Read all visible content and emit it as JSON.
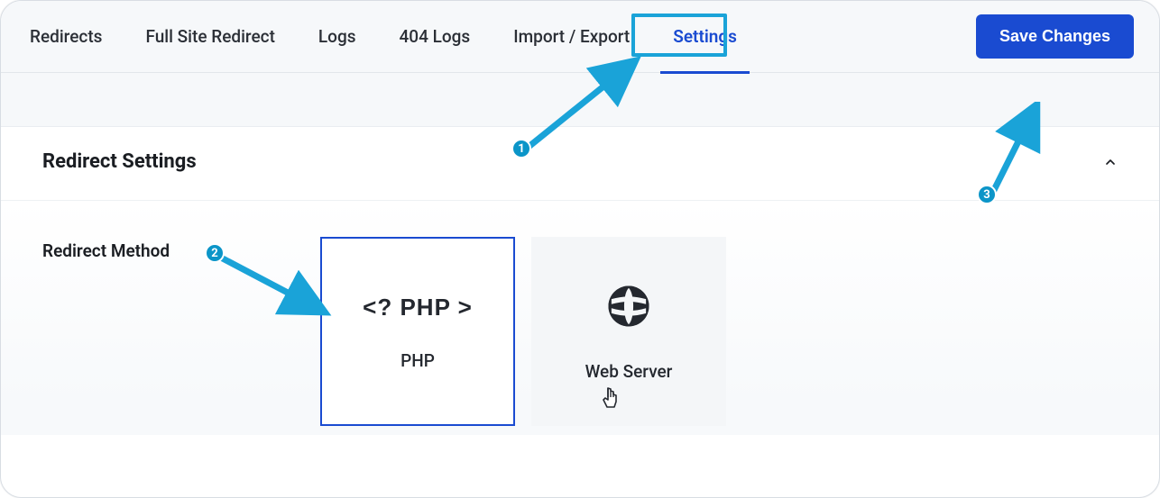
{
  "tabs": {
    "redirects": "Redirects",
    "full_site_redirect": "Full Site Redirect",
    "logs": "Logs",
    "404_logs": "404 Logs",
    "import_export": "Import / Export",
    "settings": "Settings"
  },
  "save_button": "Save Changes",
  "section": {
    "title": "Redirect Settings",
    "field_label": "Redirect Method",
    "options": {
      "php": {
        "label": "PHP",
        "icon_text": "<? PHP >"
      },
      "web_server": {
        "label": "Web Server"
      }
    }
  },
  "annotations": {
    "badge1": "1",
    "badge2": "2",
    "badge3": "3"
  }
}
